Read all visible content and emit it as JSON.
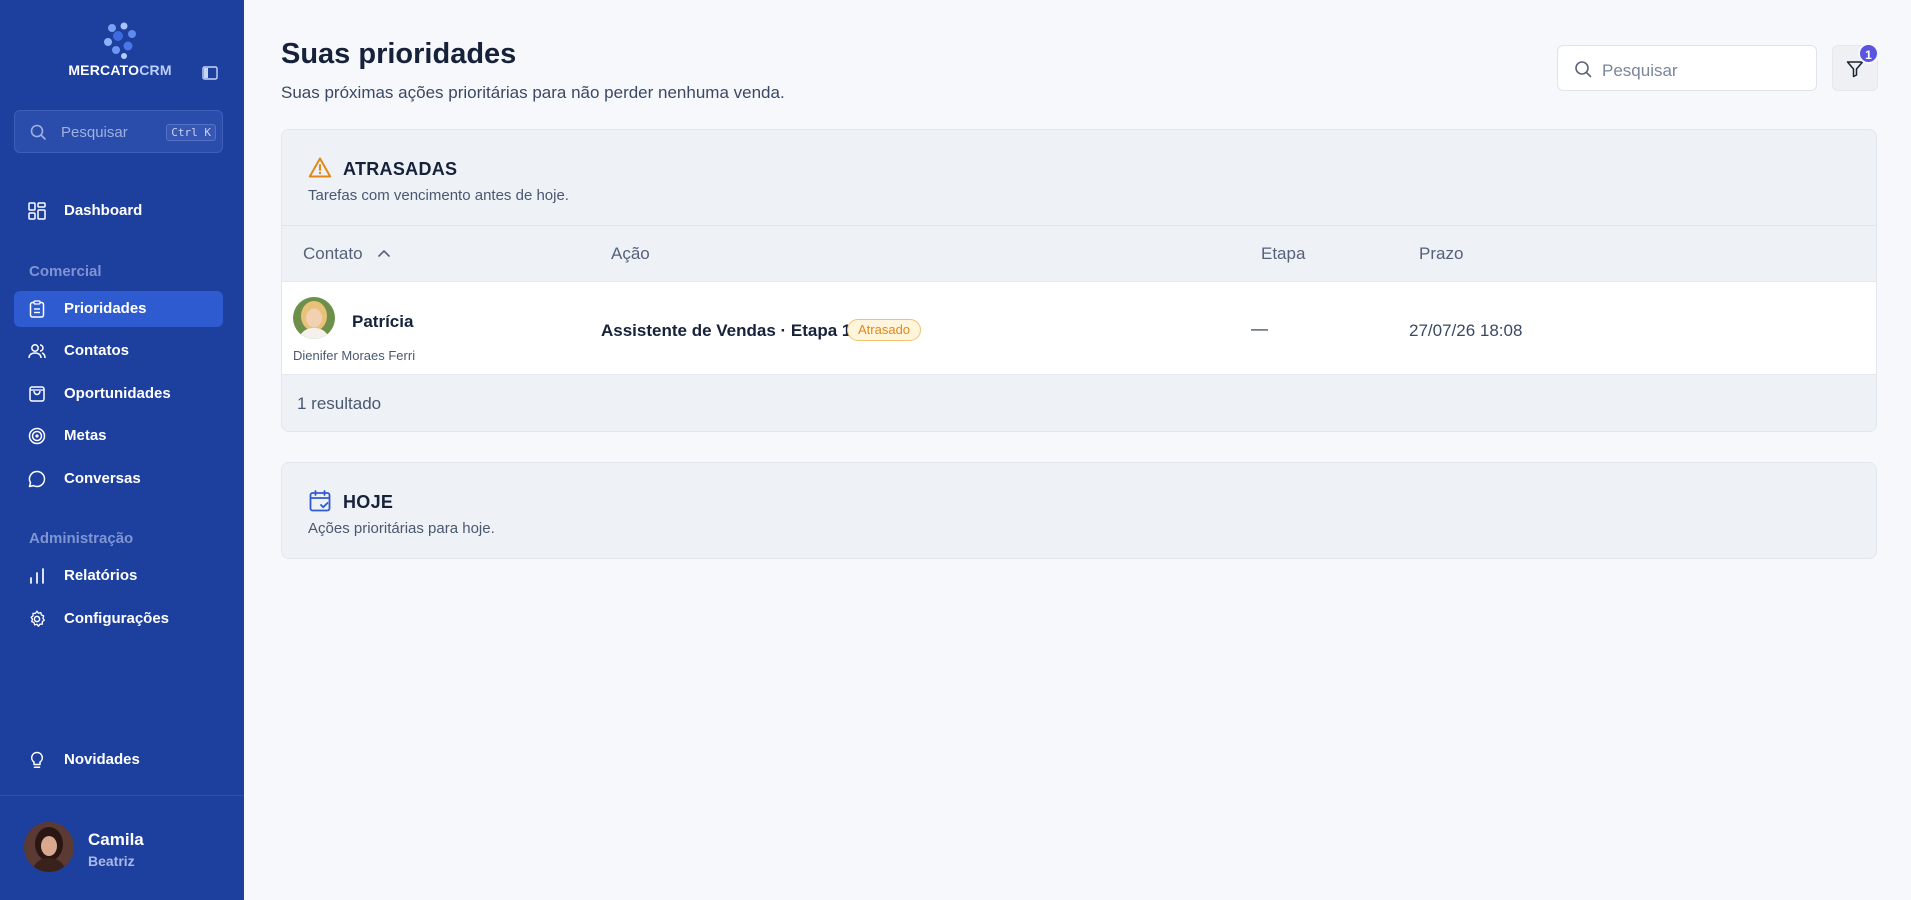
{
  "app": {
    "brand_part1": "MERCATO",
    "brand_part2": "CRM"
  },
  "sidebar": {
    "search_placeholder": "Pesquisar",
    "search_shortcut": "Ctrl K",
    "items": [
      {
        "label": "Dashboard",
        "icon": "dashboard-icon"
      },
      {
        "label": "Prioridades",
        "icon": "clipboard-icon",
        "active": true
      },
      {
        "label": "Contatos",
        "icon": "users-icon"
      },
      {
        "label": "Oportunidades",
        "icon": "shopping-bag-icon"
      },
      {
        "label": "Metas",
        "icon": "target-icon"
      },
      {
        "label": "Conversas",
        "icon": "chat-icon"
      },
      {
        "label": "Relatórios",
        "icon": "bar-chart-icon"
      },
      {
        "label": "Configurações",
        "icon": "gear-icon"
      },
      {
        "label": "Novidades",
        "icon": "lightbulb-icon"
      }
    ],
    "sections": {
      "comercial": "Comercial",
      "administracao": "Administração"
    },
    "user": {
      "name": "Camila",
      "role": "Beatriz"
    }
  },
  "header": {
    "title": "Suas prioridades",
    "subtitle": "Suas próximas ações prioritárias para não perder nenhuma venda.",
    "search_placeholder": "Pesquisar",
    "filter_count": "1"
  },
  "overdue": {
    "title": "ATRASADAS",
    "description": "Tarefas com vencimento antes de hoje.",
    "columns": [
      "Contato",
      "Ação",
      "Etapa",
      "Prazo"
    ],
    "rows": [
      {
        "contact_name": "Patrícia",
        "contact_owner": "Dienifer Moraes Ferri",
        "action": "Assistente de Vendas · Etapa 1",
        "status": "Atrasado",
        "stage": "—",
        "due": "27/07/26 18:08"
      }
    ],
    "result_count": "1 resultado"
  },
  "today": {
    "title": "HOJE",
    "description": "Ações prioritárias para hoje."
  },
  "colors": {
    "sidebar_bg": "#1d3f9e",
    "active_item": "#2f5bd0",
    "warning": "#e0891a",
    "calendar": "#2f5bd0",
    "badge": "#5b54e0"
  }
}
